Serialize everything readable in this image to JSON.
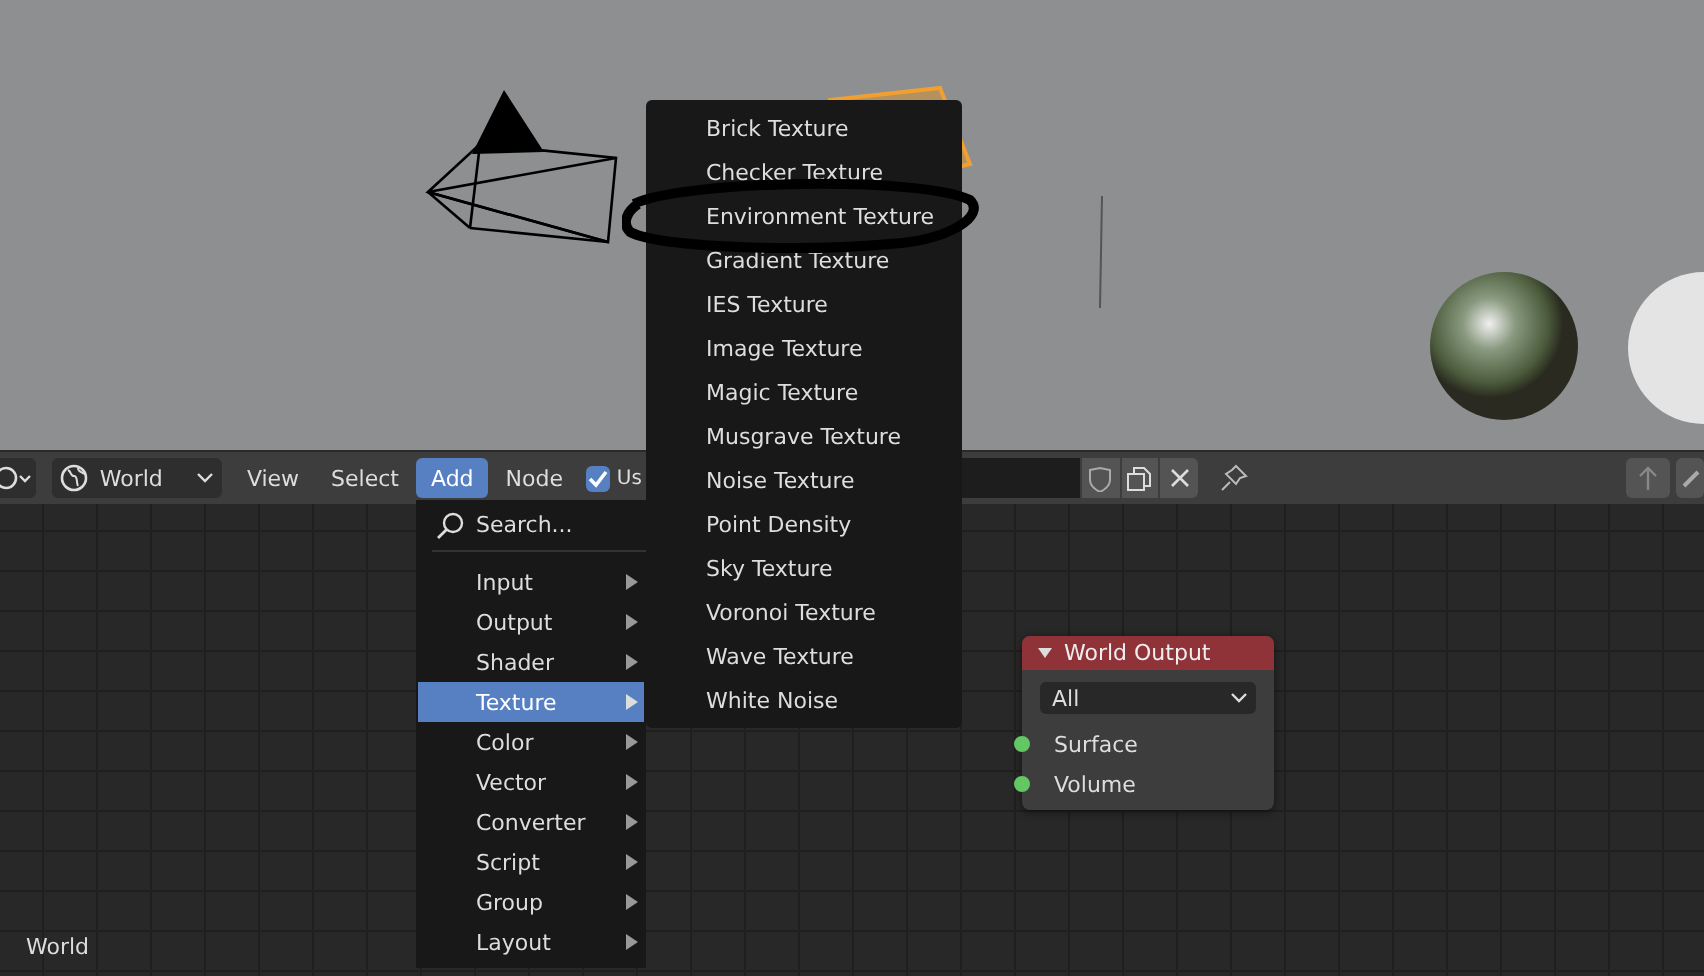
{
  "header": {
    "world_selector": "World",
    "menus": [
      {
        "label": "View",
        "selected": false
      },
      {
        "label": "Select",
        "selected": false
      },
      {
        "label": "Add",
        "selected": true
      },
      {
        "label": "Node",
        "selected": false
      }
    ],
    "use_nodes": {
      "label": "Us",
      "checked": true
    }
  },
  "add_menu": {
    "search": "Search...",
    "items": [
      {
        "label": "Input",
        "selected": false
      },
      {
        "label": "Output",
        "selected": false
      },
      {
        "label": "Shader",
        "selected": false
      },
      {
        "label": "Texture",
        "selected": true
      },
      {
        "label": "Color",
        "selected": false
      },
      {
        "label": "Vector",
        "selected": false
      },
      {
        "label": "Converter",
        "selected": false
      },
      {
        "label": "Script",
        "selected": false
      },
      {
        "label": "Group",
        "selected": false
      },
      {
        "label": "Layout",
        "selected": false
      }
    ]
  },
  "texture_menu": {
    "items": [
      "Brick Texture",
      "Checker Texture",
      "Environment Texture",
      "Gradient Texture",
      "IES Texture",
      "Image Texture",
      "Magic Texture",
      "Musgrave Texture",
      "Noise Texture",
      "Point Density",
      "Sky Texture",
      "Voronoi Texture",
      "Wave Texture",
      "White Noise"
    ]
  },
  "node": {
    "title": "World Output",
    "target": "All",
    "sockets": [
      "Surface",
      "Volume"
    ]
  },
  "footer": {
    "label": "World"
  }
}
